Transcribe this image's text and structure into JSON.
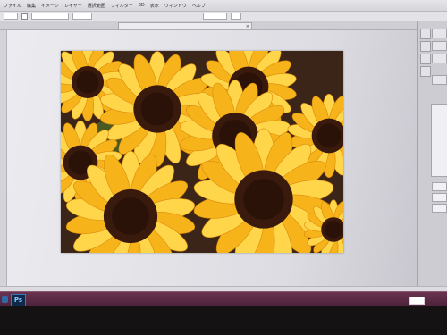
{
  "menubar": {
    "items": [
      "ファイル",
      "編集",
      "イメージ",
      "レイヤー",
      "選択範囲",
      "フィルター",
      "3D",
      "表示",
      "ウィンドウ",
      "ヘルプ"
    ]
  },
  "document_tab": {
    "title": "",
    "close_glyph": "×"
  },
  "image": {
    "subject": "sunflowers",
    "colors": {
      "petal": "#f7b31a",
      "petal_light": "#ffd54a",
      "center": "#3a1a0c",
      "background": "#3a2518"
    }
  },
  "taskbar": {
    "app_icon_label": "Ps"
  },
  "icons": [
    "photoshop-icon",
    "windows-start-icon"
  ]
}
